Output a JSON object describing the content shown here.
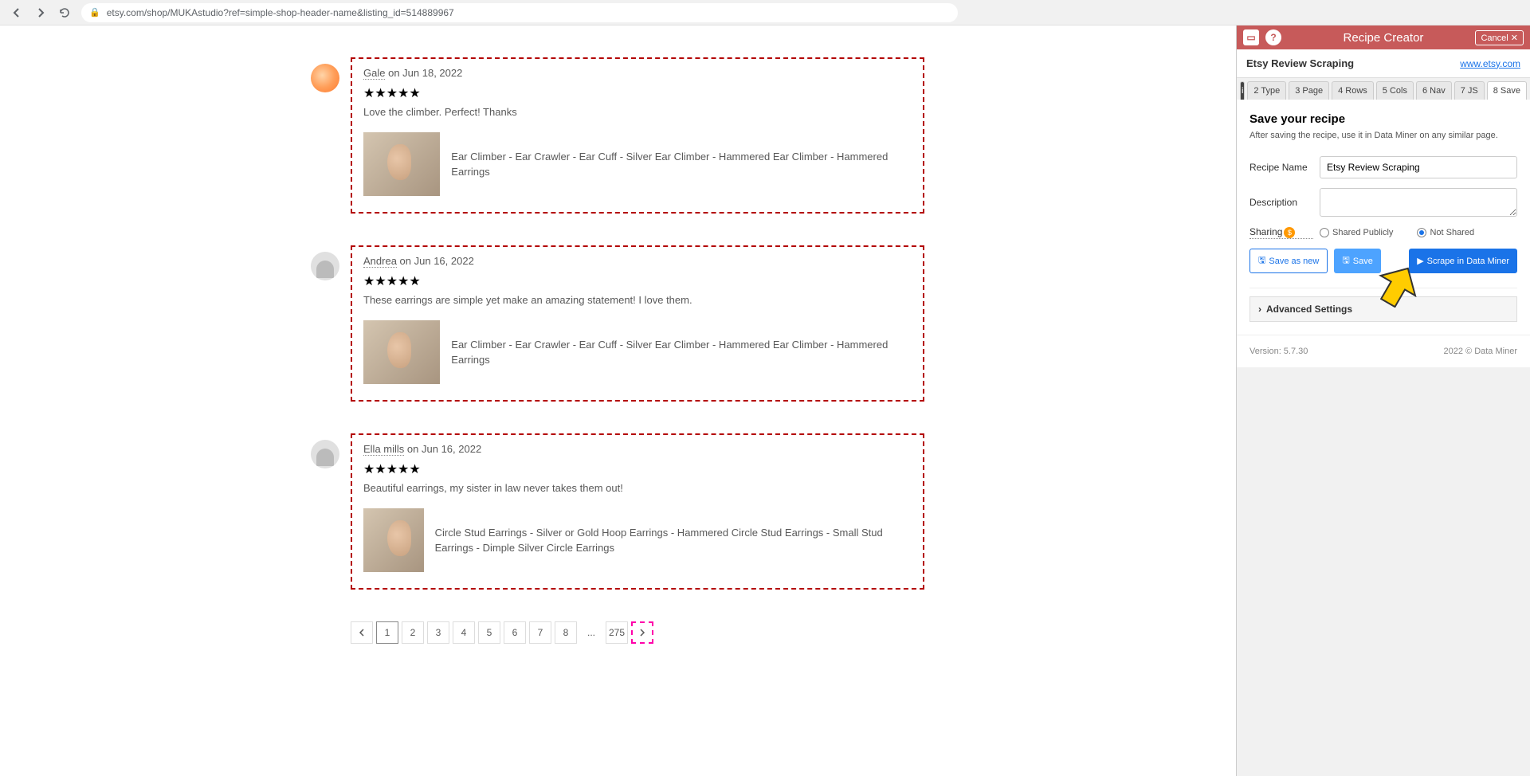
{
  "browser": {
    "url": "etsy.com/shop/MUKAstudio?ref=simple-shop-header-name&listing_id=514889967"
  },
  "reviews": [
    {
      "name": "Gale",
      "date": "on Jun 18, 2022",
      "stars": "★★★★★",
      "text": "Love the climber. Perfect! Thanks",
      "product": "Ear Climber - Ear Crawler - Ear Cuff - Silver Ear Climber - Hammered Ear Climber - Hammered Earrings"
    },
    {
      "name": "Andrea",
      "date": "on Jun 16, 2022",
      "stars": "★★★★★",
      "text": "These earrings are simple yet make an amazing statement! I love them.",
      "product": "Ear Climber - Ear Crawler - Ear Cuff - Silver Ear Climber - Hammered Ear Climber - Hammered Earrings"
    },
    {
      "name": "Ella mills",
      "date": "on Jun 16, 2022",
      "stars": "★★★★★",
      "text": "Beautiful earrings, my sister in law never takes them out!",
      "product": "Circle Stud Earrings - Silver or Gold Hoop Earrings - Hammered Circle Stud Earrings - Small Stud Earrings - Dimple Silver Circle Earrings"
    }
  ],
  "pagination": {
    "pages": [
      "1",
      "2",
      "3",
      "4",
      "5",
      "6",
      "7",
      "8"
    ],
    "ellipsis": "...",
    "last": "275"
  },
  "panel": {
    "title": "Recipe Creator",
    "cancel": "Cancel ✕",
    "subtitle": "Etsy Review Scraping",
    "link": "www.etsy.com",
    "tabs": [
      "2 Type",
      "3 Page",
      "4 Rows",
      "5 Cols",
      "6 Nav",
      "7 JS",
      "8 Save"
    ],
    "save_title": "Save your recipe",
    "save_desc": "After saving the recipe, use it in Data Miner on any similar page.",
    "labels": {
      "name": "Recipe Name",
      "desc": "Description",
      "sharing": "Sharing"
    },
    "recipe_name_value": "Etsy Review Scraping",
    "share_public": "Shared Publicly",
    "share_not": "Not Shared",
    "btn_save_new": "Save as new",
    "btn_save": "Save",
    "btn_scrape": "Scrape in Data Miner",
    "adv": "Advanced Settings",
    "version": "Version: 5.7.30",
    "copyright": "2022 © Data Miner"
  }
}
